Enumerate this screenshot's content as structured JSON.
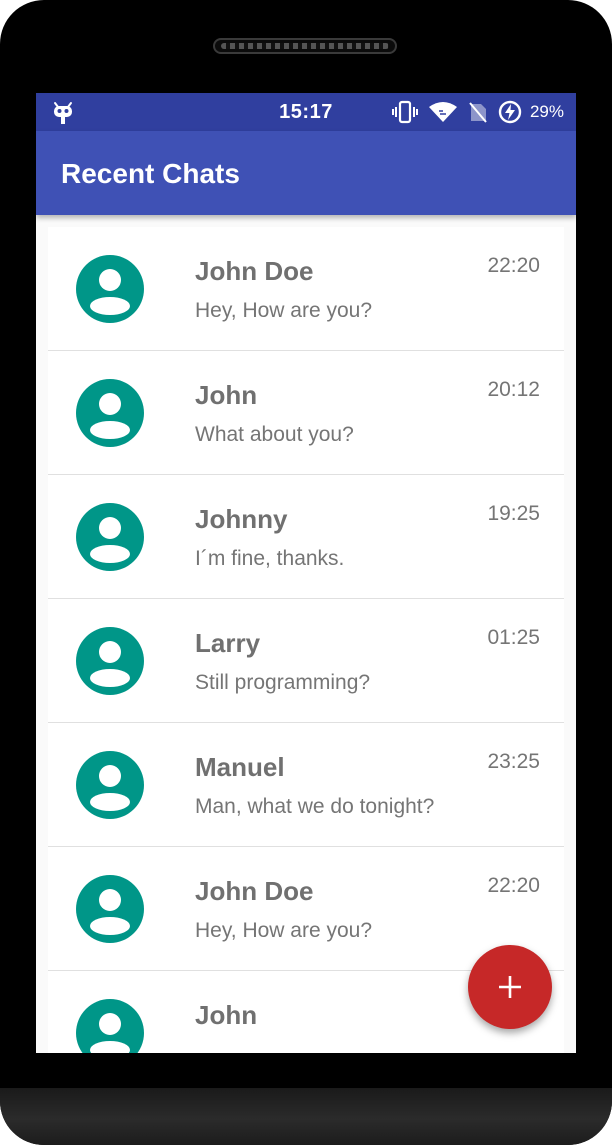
{
  "status_bar": {
    "time": "15:17",
    "battery_percent": "29%",
    "icons": [
      "android-debug-icon",
      "vibrate-icon",
      "wifi-icon",
      "no-sim-icon",
      "battery-charging-icon"
    ]
  },
  "app_bar": {
    "title": "Recent Chats"
  },
  "chats": [
    {
      "name": "John Doe",
      "message": "Hey, How are you?",
      "time": "22:20"
    },
    {
      "name": "John",
      "message": "What about you?",
      "time": "20:12"
    },
    {
      "name": "Johnny",
      "message": "I´m fine, thanks.",
      "time": "19:25"
    },
    {
      "name": "Larry",
      "message": "Still programming?",
      "time": "01:25"
    },
    {
      "name": "Manuel",
      "message": "Man, what we do tonight?",
      "time": "23:25"
    },
    {
      "name": "John Doe",
      "message": "Hey, How are you?",
      "time": "22:20"
    },
    {
      "name": "John",
      "message": "",
      "time": ""
    }
  ],
  "fab": {
    "icon": "plus-icon"
  },
  "colors": {
    "status_bar": "#303f9f",
    "app_bar": "#3f51b5",
    "avatar": "#009688",
    "fab": "#c62828"
  }
}
